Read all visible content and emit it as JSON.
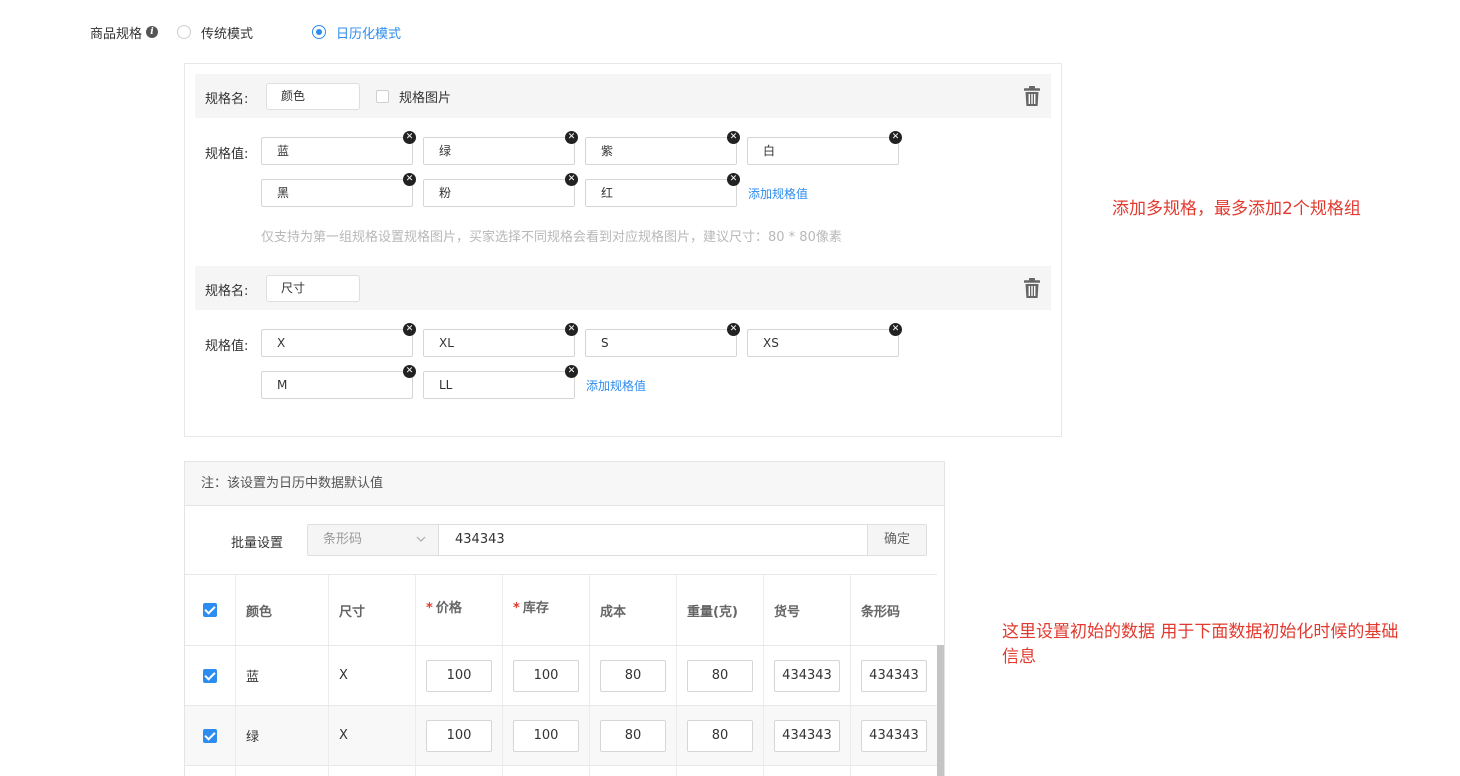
{
  "spec_mode": {
    "label": "商品规格",
    "info_icon": "info-icon",
    "options": [
      {
        "label": "传统模式",
        "checked": false
      },
      {
        "label": "日历化模式",
        "checked": true
      }
    ]
  },
  "spec_groups": [
    {
      "name_label": "规格名:",
      "name_value": "颜色",
      "image_option_label": "规格图片",
      "values_label": "规格值:",
      "values": [
        "蓝",
        "绿",
        "紫",
        "白",
        "黑",
        "粉",
        "红"
      ],
      "add_value_label": "添加规格值",
      "hint": "仅支持为第一组规格设置规格图片，买家选择不同规格会看到对应规格图片，建议尺寸：80 * 80像素"
    },
    {
      "name_label": "规格名:",
      "name_value": "尺寸",
      "values_label": "规格值:",
      "values": [
        "X",
        "XL",
        "S",
        "XS",
        "M",
        "LL"
      ],
      "add_value_label": "添加规格值"
    }
  ],
  "annotations": {
    "spec_note": "添加多规格，最多添加2个规格组",
    "default_note_line1": "这里设置初始的数据 用于下面数据初始化时候的基础",
    "default_note_line2": "信息"
  },
  "default_panel": {
    "note": "注：该设置为日历中数据默认值",
    "batch_label": "批量设置",
    "batch_select_value": "条形码",
    "batch_input_value": "434343",
    "batch_confirm_label": "确定",
    "columns": [
      {
        "label": "颜色",
        "required": false
      },
      {
        "label": "尺寸",
        "required": false
      },
      {
        "label": "价格",
        "required": true
      },
      {
        "label": "库存",
        "required": true
      },
      {
        "label": "成本",
        "required": false
      },
      {
        "label": "重量(克)",
        "required": false
      },
      {
        "label": "货号",
        "required": false
      },
      {
        "label": "条形码",
        "required": false
      }
    ],
    "rows": [
      {
        "color": "蓝",
        "size": "X",
        "price": "100",
        "stock": "100",
        "cost": "80",
        "weight": "80",
        "sku": "434343",
        "barcode": "434343"
      },
      {
        "color": "绿",
        "size": "X",
        "price": "100",
        "stock": "100",
        "cost": "80",
        "weight": "80",
        "sku": "434343",
        "barcode": "434343"
      }
    ]
  },
  "colors": {
    "accent": "#2d8cf0",
    "annotation": "#e23a2f",
    "required": "#e23a2f"
  }
}
